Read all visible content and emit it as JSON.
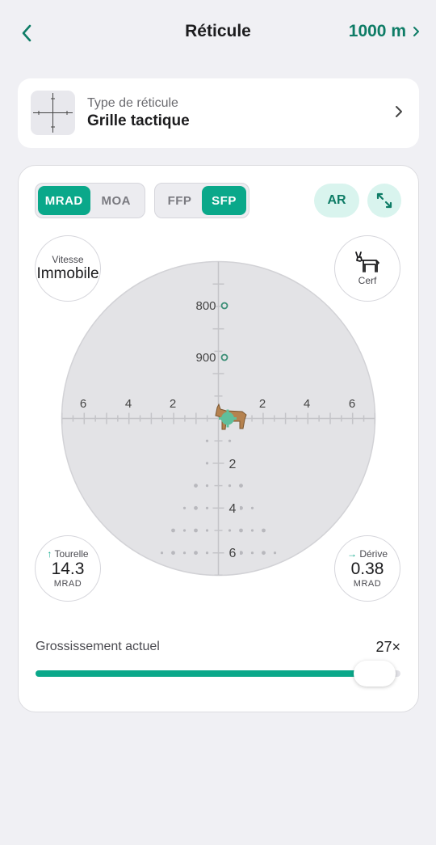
{
  "header": {
    "title": "Réticule",
    "range": "1000 m"
  },
  "reticle": {
    "label": "Type de réticule",
    "name": "Grille tactique"
  },
  "units": {
    "options": [
      "MRAD",
      "MOA"
    ],
    "selected": "MRAD"
  },
  "focal_plane": {
    "options": [
      "FFP",
      "SFP"
    ],
    "selected": "SFP"
  },
  "ar_button": "AR",
  "speed": {
    "label": "Vitesse",
    "value": "Immobile"
  },
  "target": {
    "label": "Cerf"
  },
  "turret": {
    "label": "Tourelle",
    "value": "14.3",
    "unit": "MRAD",
    "arrow": "↑"
  },
  "drift": {
    "label": "Dérive",
    "value": "0.38",
    "unit": "MRAD",
    "arrow": "→"
  },
  "scope": {
    "range_marks": [
      "800",
      "900"
    ],
    "horizontal_labels": [
      "6",
      "4",
      "2",
      "2",
      "4",
      "6"
    ],
    "vertical_labels": [
      "2",
      "4",
      "6"
    ]
  },
  "magnification": {
    "label": "Grossissement actuel",
    "value": "27×",
    "fraction": 0.93
  },
  "colors": {
    "accent": "#0aa88a",
    "accent_dark": "#0e7c66",
    "accent_light": "#d9f4ee",
    "scope_fill": "#e3e3e6",
    "deer": "#b5824f"
  }
}
